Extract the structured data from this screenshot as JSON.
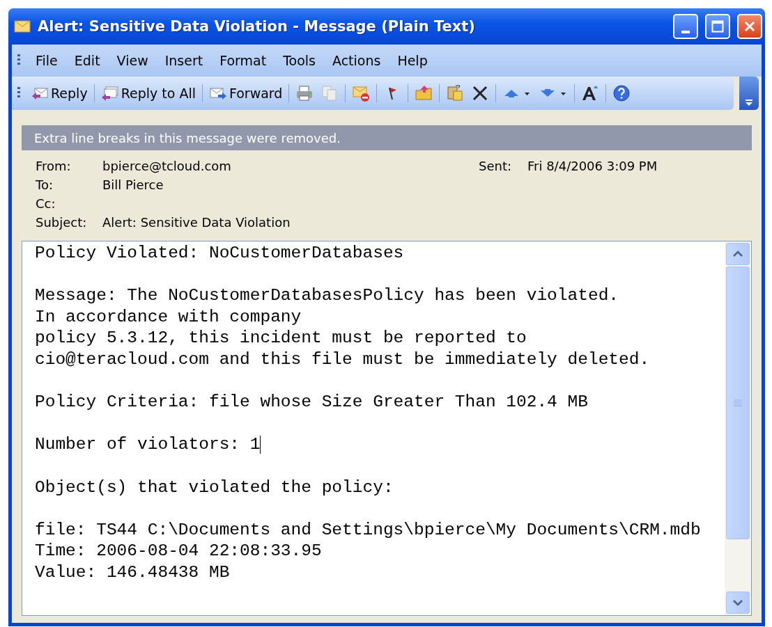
{
  "window": {
    "title": "Alert: Sensitive Data Violation - Message (Plain Text)"
  },
  "menu": [
    "File",
    "Edit",
    "View",
    "Insert",
    "Format",
    "Tools",
    "Actions",
    "Help"
  ],
  "toolbar": [
    {
      "kind": "text",
      "label": "Reply"
    },
    {
      "kind": "text",
      "label": "Reply to All"
    },
    {
      "kind": "text",
      "label": "Forward"
    },
    {
      "kind": "icon"
    },
    {
      "kind": "icon"
    },
    {
      "kind": "icon"
    },
    {
      "kind": "icon"
    },
    {
      "kind": "icon"
    },
    {
      "kind": "icon"
    },
    {
      "kind": "icon"
    },
    {
      "kind": "icon"
    },
    {
      "kind": "icon"
    },
    {
      "kind": "icon"
    },
    {
      "kind": "icon"
    }
  ],
  "info_bar": "Extra line breaks in this message were removed.",
  "header": {
    "from_label": "From:",
    "from": "bpierce@tcloud.com",
    "sent_label": "Sent:",
    "sent": "Fri 8/4/2006 3:09 PM",
    "to_label": "To:",
    "to": "Bill Pierce",
    "cc_label": "Cc:",
    "subject_label": "Subject:",
    "subject": "Alert: Sensitive Data Violation"
  },
  "body": [
    [
      "Policy Violated: NoCustomerDatabases"
    ],
    [
      "Message: The NoCustomerDatabasesPolicy has been violated.",
      "In accordance with company",
      "policy 5.3.12, this incident must be reported to",
      "cio@teracloud.com and this file must be immediately deleted."
    ],
    [
      "Policy Criteria: file whose Size Greater Than 102.4 MB"
    ],
    [
      "Number of violators: 1"
    ],
    [
      "Object(s) that violated the policy:"
    ],
    [
      "file: TS44 C:\\Documents and Settings\\bpierce\\My Documents\\CRM.mdb",
      "Time: 2006-08-04 22:08:33.95",
      "Value: 146.48438 MB"
    ]
  ]
}
